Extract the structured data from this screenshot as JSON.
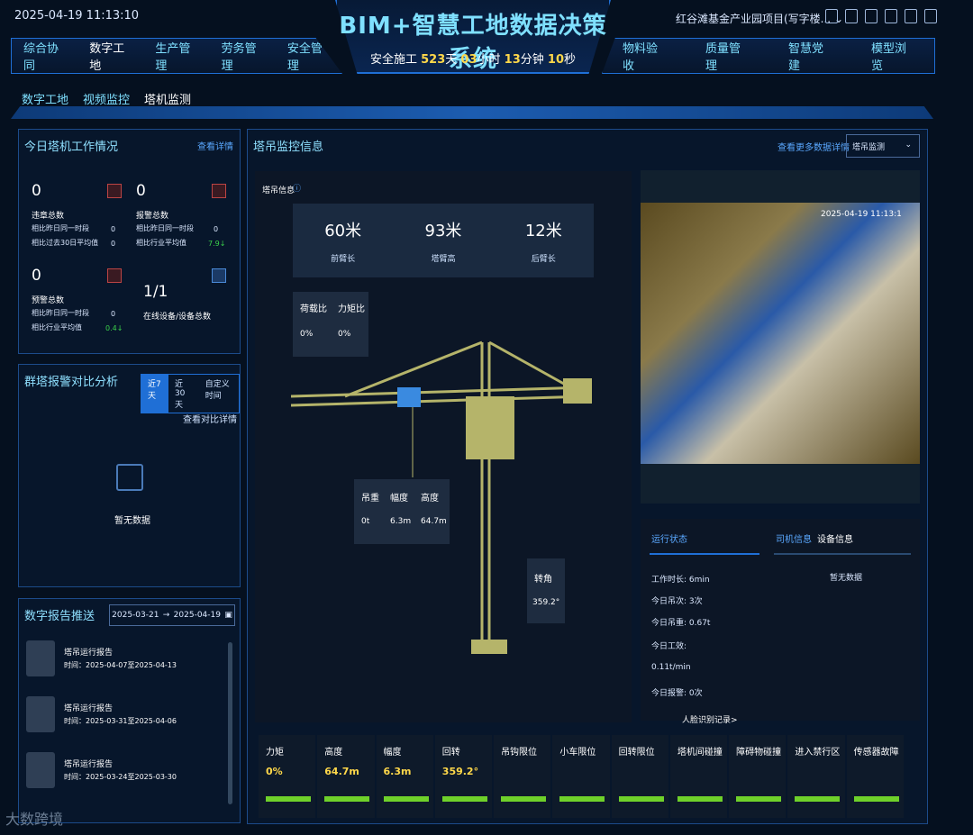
{
  "header": {
    "datetime": "2025-04-19 11:13:10",
    "title": "BIM+智慧工地数据决策系统",
    "safety_prefix": "安全施工",
    "safety_days": "523",
    "safety_days_unit": "天",
    "safety_hours": "03",
    "safety_hours_unit": "小时",
    "safety_minutes": "13",
    "safety_minutes_unit": "分钟",
    "safety_seconds": "10",
    "safety_seconds_unit": "秒",
    "project": "红谷滩基金产业园项目(写字楼..."
  },
  "nav_left": [
    "综合协同",
    "数字工地",
    "生产管理",
    "劳务管理",
    "安全管理"
  ],
  "nav_right": [
    "物料验收",
    "质量管理",
    "智慧党建",
    "模型浏览"
  ],
  "subnav": [
    "数字工地",
    "视频监控",
    "塔机监测"
  ],
  "work_panel": {
    "title": "今日塔机工作情况",
    "link": "查看详情",
    "violation_count": "0",
    "violation_label": "违章总数",
    "violation_r1": "相比昨日同一时段",
    "violation_r1v": "0",
    "violation_r2": "相比过去30日平均值",
    "violation_r2v": "0",
    "alarm_count": "0",
    "alarm_label": "报警总数",
    "alarm_r1": "相比昨日同一时段",
    "alarm_r1v": "0",
    "alarm_r2": "相比行业平均值",
    "alarm_r2v": "7.9↓",
    "warn_count": "0",
    "warn_label": "预警总数",
    "warn_r1": "相比昨日同一时段",
    "warn_r1v": "0",
    "warn_r2": "相比行业平均值",
    "warn_r2v": "0.4↓",
    "online": "1/1",
    "online_label": "在线设备/设备总数"
  },
  "alarm_panel": {
    "title": "群塔报警对比分析",
    "tabs": [
      "近7天",
      "近30天",
      "自定义时间"
    ],
    "link": "查看对比详情",
    "nodata": "暂无数据"
  },
  "report_panel": {
    "title": "数字报告推送",
    "date_from": "2025-03-21",
    "arrow": "→",
    "date_to": "2025-04-19",
    "reports": [
      {
        "title": "塔吊运行报告",
        "date": "时间：2025-04-07至2025-04-13"
      },
      {
        "title": "塔吊运行报告",
        "date": "时间：2025-03-31至2025-04-06"
      },
      {
        "title": "塔吊运行报告",
        "date": "时间：2025-03-24至2025-03-30"
      }
    ]
  },
  "monitor": {
    "title": "塔吊监控信息",
    "link": "查看更多数据详情",
    "select": "塔吊监测",
    "info_label": "塔吊信息",
    "front_arm": "60米",
    "front_arm_label": "前臂长",
    "tower_height": "93米",
    "tower_height_label": "塔臂高",
    "back_arm": "12米",
    "back_arm_label": "后臂长",
    "load_ratio_label": "荷载比",
    "load_ratio": "0%",
    "moment_ratio_label": "力矩比",
    "moment_ratio": "0%",
    "hook_label": "吊重",
    "hook": "0t",
    "range_label": "幅度",
    "range": "6.3m",
    "height_label": "高度",
    "height": "64.7m",
    "rotation_label": "转角",
    "rotation": "359.2°",
    "camera_timestamp": "2025-04-19 11:13:1",
    "status_tab": "运行状态",
    "driver_tab": "司机信息",
    "device_tab": "设备信息",
    "work_time": "工作时长: 6min",
    "lifts_today": "今日吊次: 3次",
    "weight_today": "今日吊重: 0.67t",
    "efficiency_label": "今日工效:",
    "efficiency": "0.11t/min",
    "alarms_today": "今日报警: 0次",
    "nodata": "暂无数据",
    "face_link": "人脸识别记录>"
  },
  "sensors": [
    {
      "label": "力矩",
      "value": "0%"
    },
    {
      "label": "高度",
      "value": "64.7m"
    },
    {
      "label": "幅度",
      "value": "6.3m"
    },
    {
      "label": "回转",
      "value": "359.2°"
    },
    {
      "label": "吊钩限位",
      "value": ""
    },
    {
      "label": "小车限位",
      "value": ""
    },
    {
      "label": "回转限位",
      "value": ""
    },
    {
      "label": "塔机间碰撞",
      "value": ""
    },
    {
      "label": "障碍物碰撞",
      "value": ""
    },
    {
      "label": "进入禁行区",
      "value": ""
    },
    {
      "label": "传感器故障",
      "value": ""
    }
  ],
  "watermark": "大数跨境"
}
